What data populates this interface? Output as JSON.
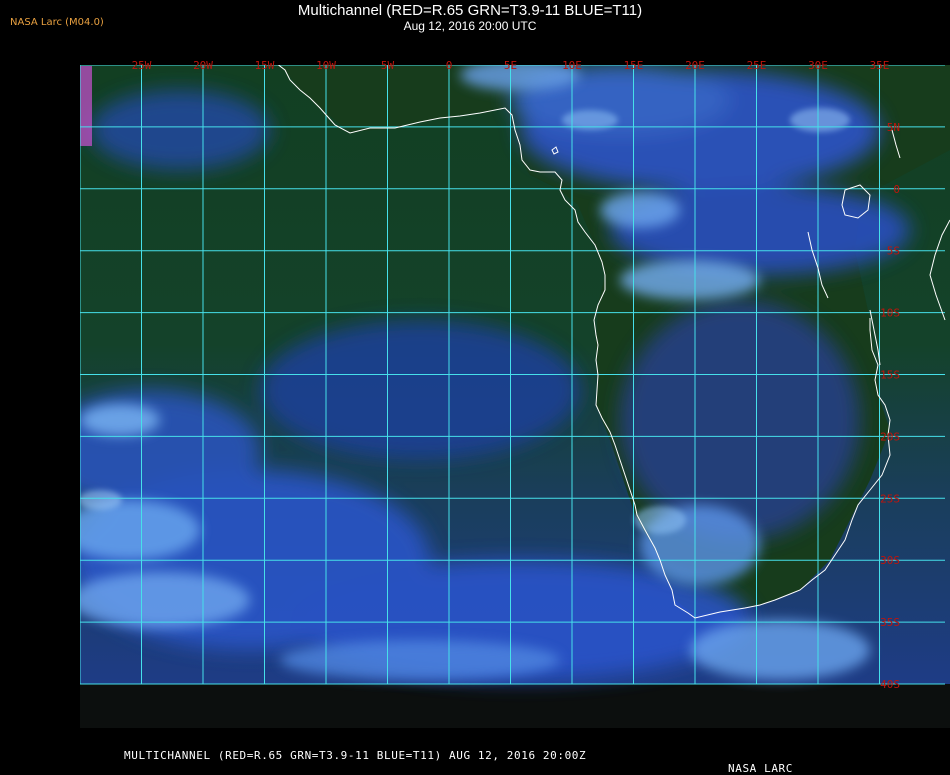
{
  "header": {
    "credit": "NASA Larc (M04.0)",
    "title": "Multichannel (RED=R.65 GRN=T3.9-11 BLUE=T11)",
    "subtitle": "Aug 12, 2016 20:00 UTC"
  },
  "footer": {
    "caption": "MULTICHANNEL (RED=R.65 GRN=T3.9-11 BLUE=T11) AUG 12, 2016 20:00Z",
    "source": "NASA LARC"
  },
  "map": {
    "lon_labels": [
      "25W",
      "20W",
      "15W",
      "10W",
      "5W",
      "0",
      "5E",
      "10E",
      "15E",
      "20E",
      "25E",
      "30E",
      "35E"
    ],
    "lat_labels": [
      "5N",
      "0",
      "5S",
      "10S",
      "15S",
      "20S",
      "25S",
      "30S",
      "35S",
      "40S"
    ],
    "colors": {
      "grid": "#46e0ea",
      "labels": "#c0140c",
      "coastline": "#ffffff",
      "ocean": "#0f3a24",
      "land": "#163e1a",
      "cloud": "#2f58d6",
      "cloud_light": "#78b0f2"
    }
  }
}
